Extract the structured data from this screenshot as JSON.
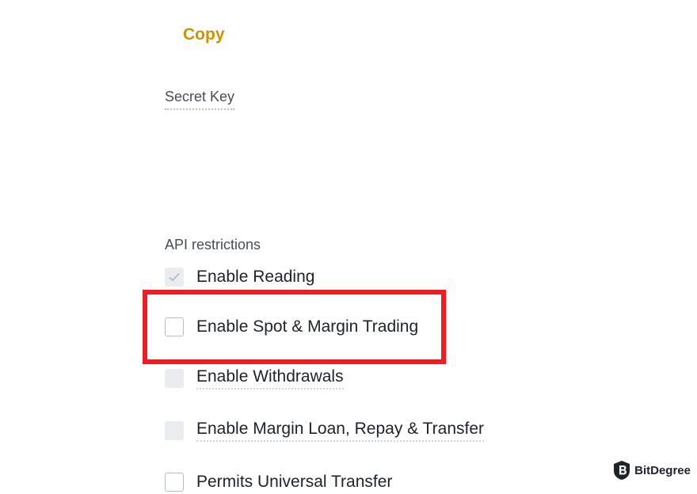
{
  "copy_label": "Copy",
  "secret_key_label": "Secret Key",
  "restrictions": {
    "title": "API restrictions",
    "options": [
      {
        "label": "Enable Reading",
        "state": "checked-disabled"
      },
      {
        "label": "Enable Spot & Margin Trading",
        "state": "unchecked"
      },
      {
        "label": "Enable Withdrawals",
        "state": "disabled"
      },
      {
        "label": "Enable Margin Loan, Repay & Transfer",
        "state": "disabled"
      },
      {
        "label": "Permits Universal Transfer",
        "state": "unchecked"
      }
    ]
  },
  "watermark": "BitDegree",
  "colors": {
    "accent": "#c99400",
    "highlight": "#ee1c25"
  },
  "icons": {
    "checkmark": "checkmark-icon",
    "logo": "bitdegree-logo-icon"
  }
}
